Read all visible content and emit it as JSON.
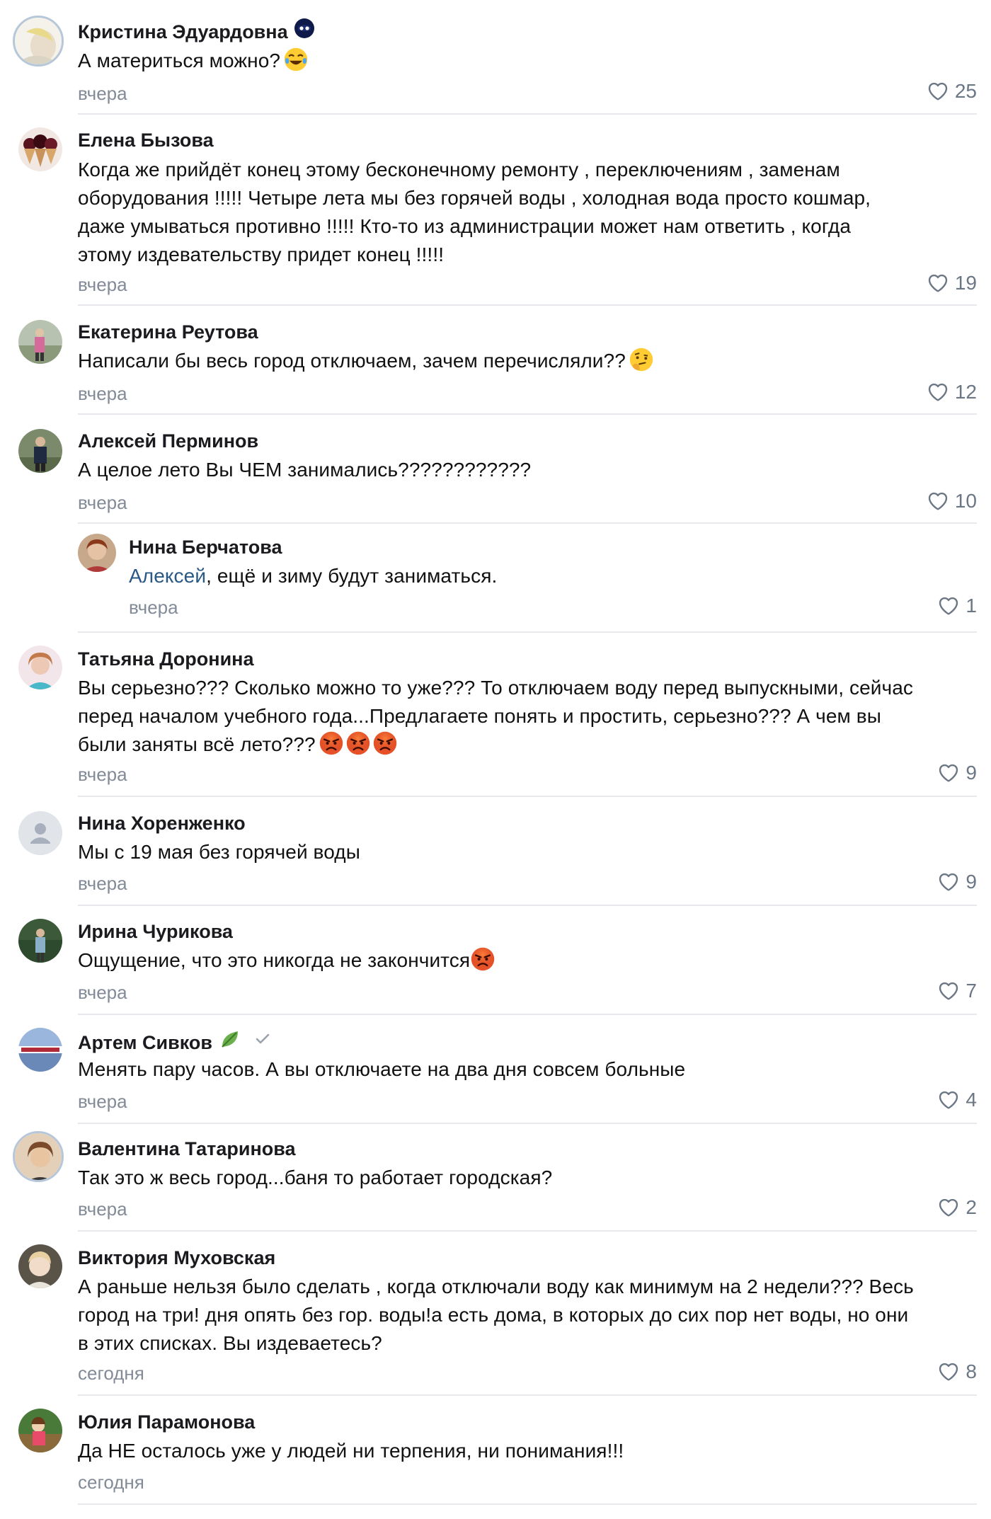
{
  "comments": [
    {
      "author": "Кристина Эдуардовна",
      "text": "А материться можно?",
      "time": "вчера",
      "likes": "25"
    },
    {
      "author": "Елена Бызова",
      "text": "Когда же прийдёт конец этому бесконечному ремонту , переключениям , заменам\nоборудования !!!!! Четыре лета мы без горячей воды , холодная вода просто кошмар,\nдаже умываться противно !!!!! Кто-то из администрации может нам ответить , когда\nэтому издевательству придет конец !!!!!",
      "time": "вчера",
      "likes": "19"
    },
    {
      "author": "Екатерина Реутова",
      "text": "Написали бы весь город отключаем, зачем перечисляли??",
      "time": "вчера",
      "likes": "12"
    },
    {
      "author": "Алексей Перминов",
      "text": "А целое лето Вы ЧЕМ занимались????????????",
      "time": "вчера",
      "likes": "10"
    },
    {
      "author": "Нина Берчатова",
      "mention": "Алексей",
      "text": ", ещё и зиму будут заниматься.",
      "time": "вчера",
      "likes": "1"
    },
    {
      "author": "Татьяна Доронина",
      "text": "Вы серьезно??? Сколько можно то уже??? То отключаем воду перед выпускными, сейчас\nперед началом учебного года...Предлагаете понять и простить, серьезно??? А чем вы\nбыли заняты всё лето???",
      "time": "вчера",
      "likes": "9"
    },
    {
      "author": "Нина Хоренженко",
      "text": "Мы с 19 мая без горячей воды",
      "time": "вчера",
      "likes": "9"
    },
    {
      "author": "Ирина Чурикова",
      "text": "Ощущение, что это никогда не закончится",
      "time": "вчера",
      "likes": "7"
    },
    {
      "author": "Артем Сивков",
      "text": "Менять пару часов. А вы отключаете на два дня совсем больные",
      "time": "вчера",
      "likes": "4"
    },
    {
      "author": "Валентина Татаринова",
      "text": "Так это ж весь город...баня то работает городская?",
      "time": "вчера",
      "likes": "2"
    },
    {
      "author": "Виктория Муховская",
      "text": "А раньше нельзя было сделать , когда отключали воду как минимум на 2 недели??? Весь\nгород на три! дня опять без гор. воды!а есть дома, в которых до сих пор нет воды, но они\nв этих списках. Вы издеваетесь?",
      "time": "сегодня",
      "likes": "8"
    },
    {
      "author": "Юлия Парамонова",
      "text": "Да НЕ осталось уже у людей ни терпения, ни понимания!!!",
      "time": "сегодня",
      "likes": ""
    }
  ],
  "colors": {
    "mention": "#2a5885",
    "time": "#828b97",
    "likes": "#6c7785",
    "divider": "#e7e8ec"
  }
}
